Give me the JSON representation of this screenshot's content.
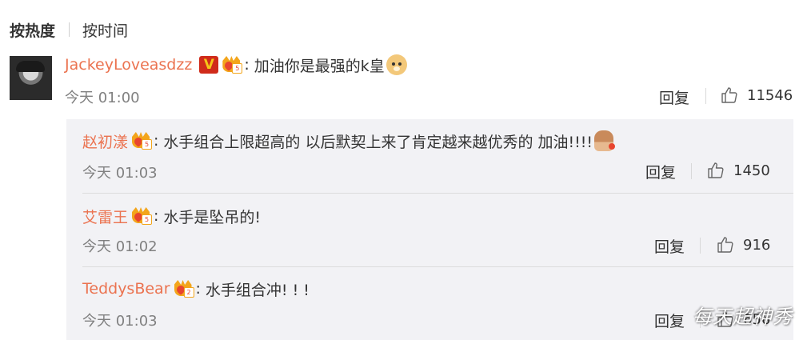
{
  "sort": {
    "hot_label": "按热度",
    "time_label": "按时间"
  },
  "main_comment": {
    "user": "JackeyLoveasdzz",
    "text": "加油你是最强的k皇",
    "time": "今天 01:00",
    "reply_label": "回复",
    "likes": "11546",
    "fan_level": "5"
  },
  "replies": [
    {
      "user": "赵初漾",
      "text": "水手组合上限超高的 以后默契上来了肯定越来越优秀的 加油!!!!",
      "time": "今天 01:03",
      "reply_label": "回复",
      "likes": "1450",
      "fan_level": "5"
    },
    {
      "user": "艾雷王",
      "text": "水手是坠吊的!",
      "time": "今天 01:02",
      "reply_label": "回复",
      "likes": "916",
      "fan_level": "5"
    },
    {
      "user": "TeddysBear",
      "text": "水手组合冲! ! !",
      "time": "今天 01:03",
      "reply_label": "回复",
      "likes": "656",
      "fan_level": "2"
    }
  ],
  "watermark": "每天超神秀",
  "colors": {
    "username": "#eb7350",
    "reply_bg": "#f2f2f5",
    "muted": "#808080"
  },
  "icons": {
    "like": "thumbs-up-icon",
    "vip": "vip-badge-icon",
    "fan": "fan-crown-badge-icon"
  }
}
